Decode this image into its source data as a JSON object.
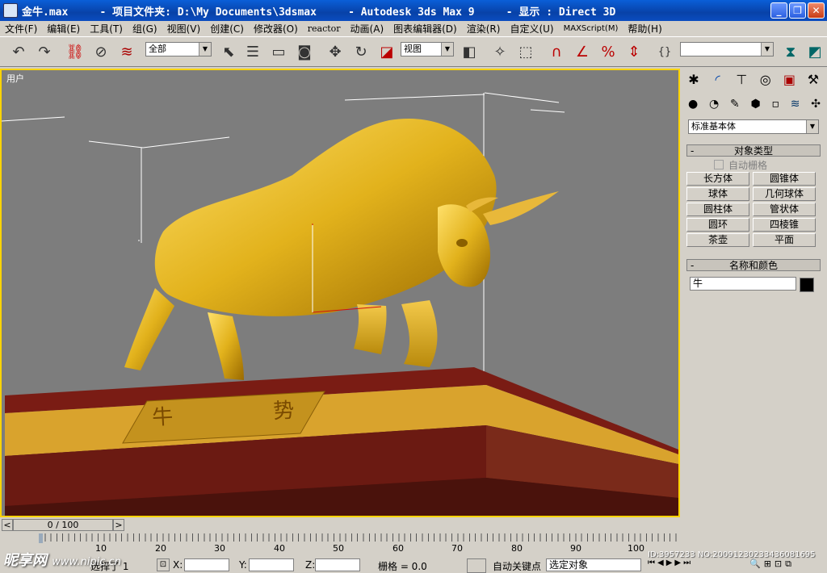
{
  "title_bar": {
    "title": "金牛.max     - 项目文件夹: D:\\My Documents\\3dsmax     - Autodesk 3ds Max 9     - 显示 : Direct 3D",
    "minimize": "_",
    "restore": "❐",
    "close": "✕"
  },
  "menu": [
    "文件(F)",
    "编辑(E)",
    "工具(T)",
    "组(G)",
    "视图(V)",
    "创建(C)",
    "修改器(O)",
    "reactor",
    "动画(A)",
    "图表编辑器(D)",
    "渲染(R)",
    "自定义(U)",
    "MAXScript(M)",
    "帮助(H)"
  ],
  "toolbar": {
    "selection_filter": "全部",
    "reference_coord": "视图",
    "named_selection": ""
  },
  "viewport": {
    "label": "用户",
    "base_text": "牛 势",
    "border_color": "#ffd400"
  },
  "command_panel": {
    "category": "标准基本体",
    "object_type_title": "对象类型",
    "auto_grid": "自动栅格",
    "buttons": [
      "长方体",
      "圆锥体",
      "球体",
      "几何球体",
      "圆柱体",
      "管状体",
      "圆环",
      "四棱锥",
      "茶壶",
      "平面"
    ],
    "name_color_title": "名称和颜色",
    "object_name": "牛",
    "rollout_minus": "-"
  },
  "timeline": {
    "slider": "0 / 100",
    "prev": "<",
    "next": ">",
    "ticks": [
      "10",
      "20",
      "30",
      "40",
      "50",
      "60",
      "70",
      "80",
      "90",
      "100"
    ]
  },
  "status": {
    "selected": "选择了 1",
    "x_label": "X:",
    "y_label": "Y:",
    "z_label": "Z:",
    "grid": "栅格 = 0.0",
    "auto_key": "自动关键点",
    "selected_objects": "选定对象"
  },
  "watermark": {
    "brand": "昵享网",
    "url": "www.nipic.cn",
    "id": "ID:3957233 NO:20091230233436081695"
  }
}
